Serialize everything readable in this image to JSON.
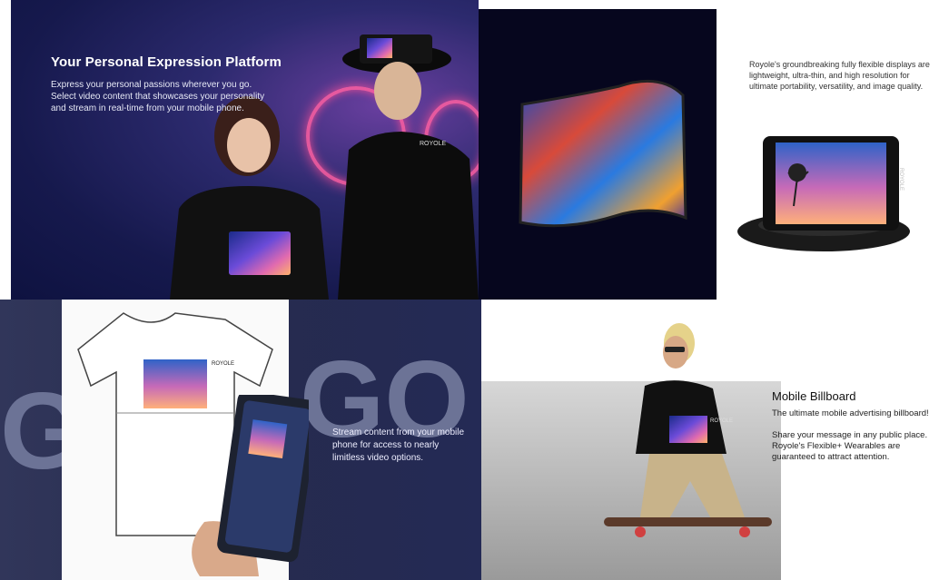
{
  "panel_expression": {
    "title": "Your Personal Expression Platform",
    "description": "Express your personal passions wherever you go. Select video content that showcases your personality and stream in real-time from your mobile phone.",
    "shirt_logo": "ROYOLE"
  },
  "panel_flexible_display": {
    "description": "Royole's groundbreaking fully flexible displays are lightweight, ultra-thin, and high resolution for ultimate portability, versatility, and image quality.",
    "device_logo": "ROYOLE"
  },
  "panel_stream": {
    "background_text_left": "G",
    "background_text_right": "GO",
    "shirt_logo": "ROYOLE",
    "description": "Stream content from your mobile phone for access to nearly limitless video options."
  },
  "panel_billboard": {
    "title": "Mobile Billboard",
    "description_1": "The ultimate mobile advertising billboard!",
    "description_2": "Share your message in any public place. Royole's Flexible+ Wearables are guaranteed to attract attention.",
    "shirt_logo": "ROYOLE"
  }
}
